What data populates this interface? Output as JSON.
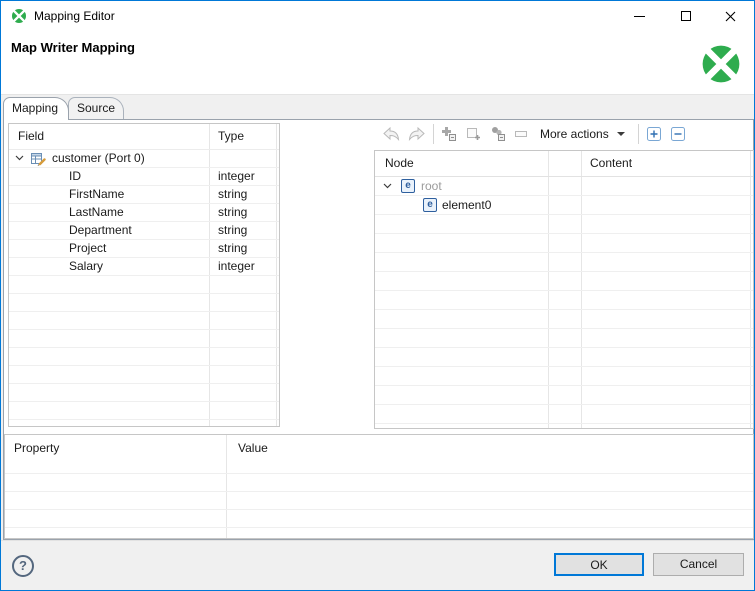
{
  "window": {
    "title": "Mapping Editor"
  },
  "header": {
    "title": "Map Writer Mapping"
  },
  "tabs": {
    "mapping": "Mapping",
    "source": "Source"
  },
  "field_table": {
    "col_field": "Field",
    "col_type": "Type",
    "root_label": "customer (Port 0)",
    "rows": [
      {
        "field": "ID",
        "type": "integer"
      },
      {
        "field": "FirstName",
        "type": "string"
      },
      {
        "field": "LastName",
        "type": "string"
      },
      {
        "field": "Department",
        "type": "string"
      },
      {
        "field": "Project",
        "type": "string"
      },
      {
        "field": "Salary",
        "type": "integer"
      }
    ]
  },
  "toolbar": {
    "more_actions": "More actions"
  },
  "node_table": {
    "col_node": "Node",
    "col_content": "Content",
    "rows": [
      {
        "badge": "e",
        "label": "root"
      },
      {
        "badge": "e",
        "label": "element0"
      }
    ]
  },
  "property_table": {
    "col_property": "Property",
    "col_value": "Value"
  },
  "footer": {
    "help": "?",
    "ok": "OK",
    "cancel": "Cancel"
  },
  "colors": {
    "accent_blue": "#0078d7",
    "clover_green": "#2eac4e",
    "element_blue": "#2e5f9e",
    "muted_text": "#9b9b9b"
  }
}
